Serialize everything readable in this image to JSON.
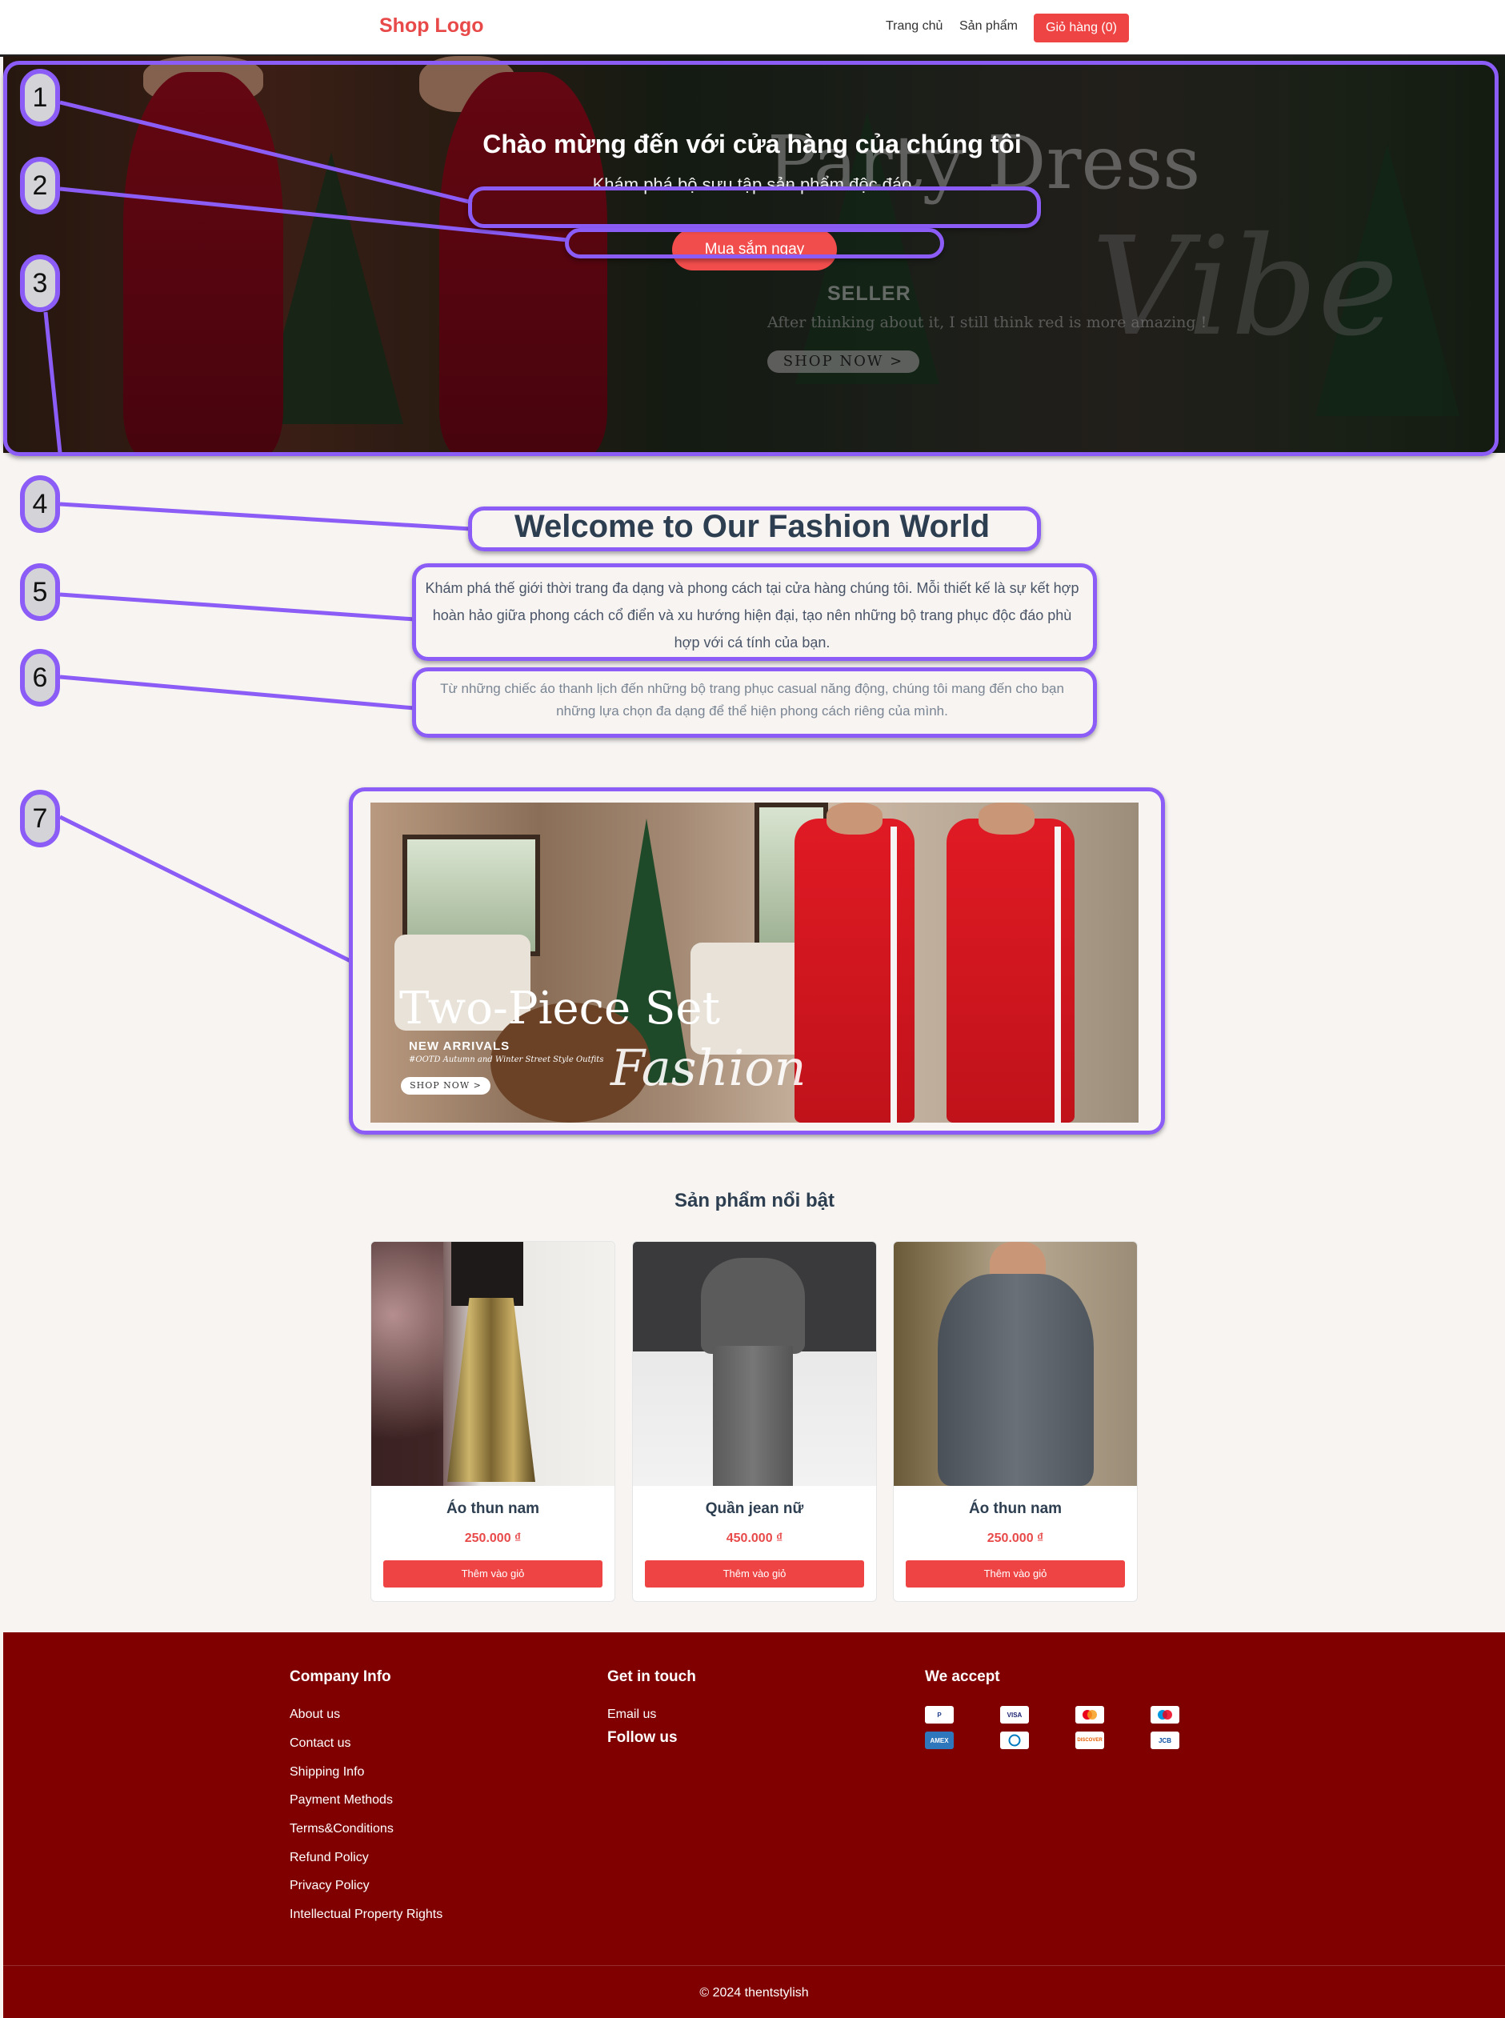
{
  "navbar": {
    "logo": "Shop Logo",
    "links": [
      "Trang chủ",
      "Sản phẩm"
    ],
    "cart_label": "Giỏ hàng (0)"
  },
  "hero": {
    "title": "Chào mừng đến với cửa hàng của chúng tôi",
    "subtitle": "Khám phá bộ sưu tập sản phẩm độc đáo",
    "button_label": "Mua sắm ngay",
    "image_text": {
      "headline": "Party Dress",
      "script": "Vibe",
      "badge": "SELLER",
      "tagline": "After thinking about it, I still think red is more amazing !",
      "cta": "SHOP NOW >"
    }
  },
  "intro": {
    "heading": "Welcome to Our Fashion World",
    "paragraph1": "Khám phá thế giới thời trang đa dạng và phong cách tại cửa hàng chúng tôi. Mỗi thiết kế là sự kết hợp hoàn hảo giữa phong cách cổ điển và xu hướng hiện đại, tạo nên những bộ trang phục độc đáo phù hợp với cá tính của bạn.",
    "paragraph2": "Từ những chiếc áo thanh lịch đến những bộ trang phục casual năng động, chúng tôi mang đến cho bạn những lựa chọn đa dạng để thể hiện phong cách riêng của mình."
  },
  "banner": {
    "title": "Two-Piece Set",
    "new_arrivals": "NEW ARRIVALS",
    "ootd": "#OOTD Autumn and Winter Street Style Outfits",
    "script": "Fashion",
    "cta": "SHOP NOW >"
  },
  "featured": {
    "heading": "Sản phẩm nổi bật",
    "products": [
      {
        "name": "Áo thun nam",
        "price": "250.000 ₫",
        "button": "Thêm vào giỏ"
      },
      {
        "name": "Quần jean nữ",
        "price": "450.000 ₫",
        "button": "Thêm vào giỏ"
      },
      {
        "name": "Áo thun nam",
        "price": "250.000 ₫",
        "button": "Thêm vào giỏ"
      }
    ]
  },
  "footer": {
    "company_heading": "Company Info",
    "company_links": [
      "About us",
      "Contact us",
      "Shipping Info",
      "Payment Methods",
      "Terms&Conditions",
      "Refund Policy",
      "Privacy Policy",
      "Intellectual Property Rights"
    ],
    "contact_heading": "Get in touch",
    "email_link": "Email us",
    "follow_heading": "Follow us",
    "payment_heading": "We accept",
    "payment_methods": [
      "paypal-icon",
      "visa-icon",
      "mastercard-icon",
      "maestro-icon",
      "amex-icon",
      "diners-icon",
      "discover-icon",
      "jcb-icon"
    ],
    "copyright": "© 2024 thentstylish"
  },
  "annotations": [
    "1",
    "2",
    "3",
    "4",
    "5",
    "6",
    "7"
  ],
  "colors": {
    "accent": "#ef4444",
    "footer_bg": "#800000",
    "annotation": "#8b5cf6",
    "heading": "#2c3e50"
  }
}
